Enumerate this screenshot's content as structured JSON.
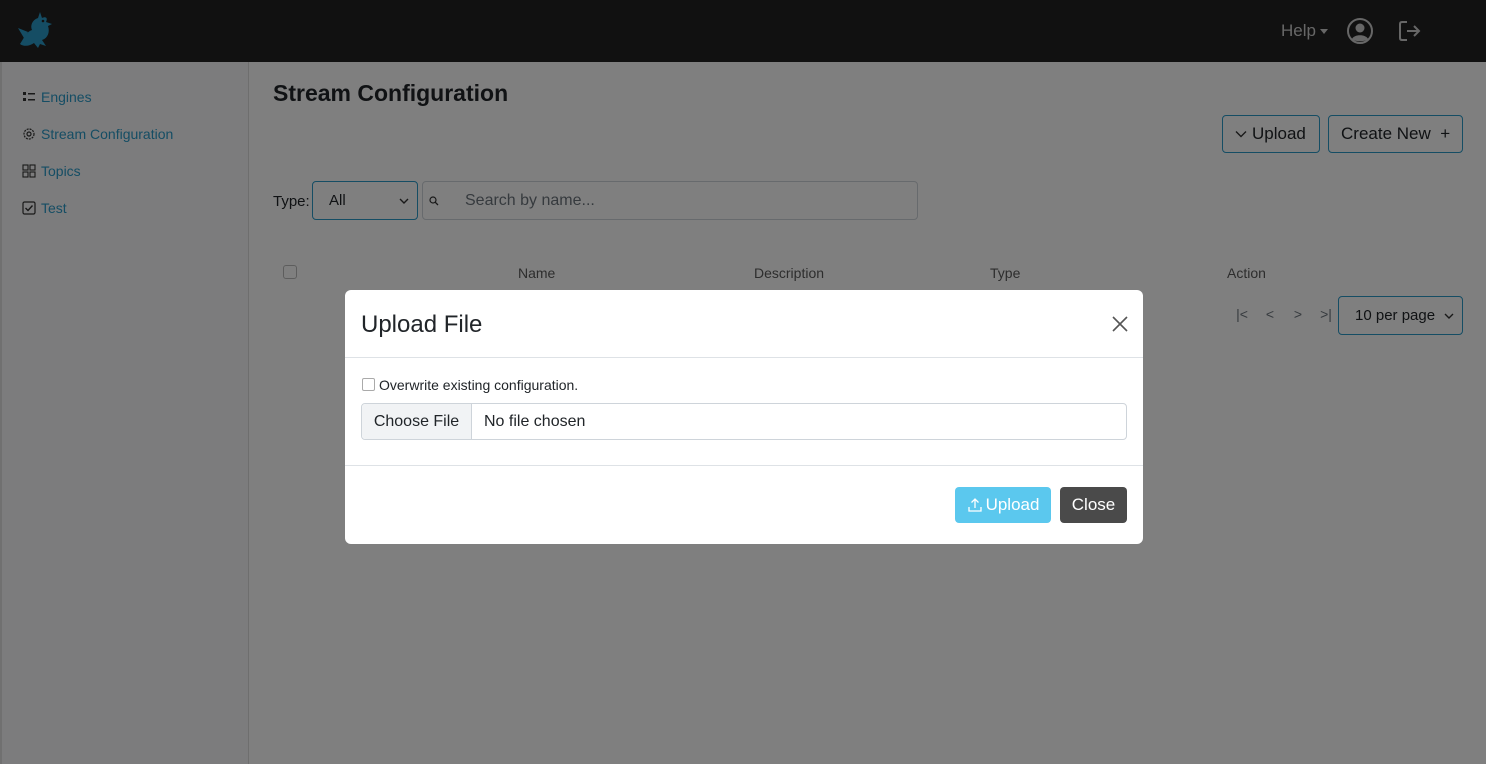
{
  "app": {
    "logo_icon": "dragon-logo-icon",
    "brand_color": "#2b9bc9"
  },
  "header": {
    "help_label": "Help",
    "avatar_icon": "user-avatar-icon",
    "logout_icon": "logout-icon"
  },
  "sidebar": {
    "items": [
      {
        "label": "Engines",
        "icon": "engines-list-icon"
      },
      {
        "label": "Stream Configuration",
        "icon": "gear-icon"
      },
      {
        "label": "Topics",
        "icon": "grid-icon"
      },
      {
        "label": "Test",
        "icon": "checkbox-icon"
      }
    ]
  },
  "main": {
    "title": "Stream Configuration",
    "upload_button": "Upload",
    "create_button": "Create New  +",
    "type_label": "Type:",
    "type_value": "All",
    "search_placeholder": "Search by name...",
    "columns": [
      "Name",
      "Description",
      "Type",
      "Action"
    ],
    "pager": [
      "|<",
      "<",
      ">",
      ">|"
    ],
    "per_page": "10 per page"
  },
  "modal": {
    "title": "Upload File",
    "overwrite_label": "Overwrite existing configuration.",
    "choose_file": "Choose File",
    "file_status": "No file chosen",
    "upload_label": "Upload",
    "close_label": "Close",
    "upload_color": "#5bc8ee",
    "close_color": "#4a4a4a"
  }
}
